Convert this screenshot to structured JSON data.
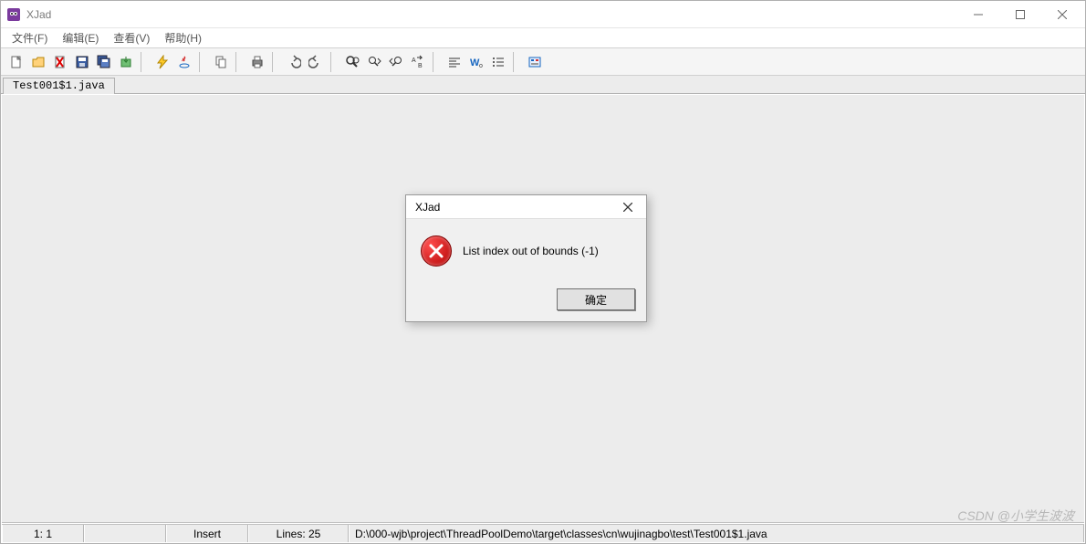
{
  "window": {
    "title": "XJad"
  },
  "menu": {
    "file": "文件(F)",
    "edit": "编辑(E)",
    "view": "查看(V)",
    "help": "帮助(H)"
  },
  "toolbar": {
    "icons": [
      "new-file-icon",
      "open-file-icon",
      "delete-icon",
      "save-icon",
      "save-all-icon",
      "export-icon",
      "sep",
      "lightning-icon",
      "java-icon",
      "sep",
      "copy-icon",
      "sep",
      "print-icon",
      "sep",
      "undo-icon",
      "redo-icon",
      "sep",
      "find-icon",
      "find-next-icon",
      "find-prev-icon",
      "replace-icon",
      "sep",
      "align-left-icon",
      "wrap-icon",
      "list-icon",
      "sep",
      "options-icon"
    ]
  },
  "tabs": {
    "active": "Test001$1.java"
  },
  "statusbar": {
    "position": "1:  1",
    "mode": "Insert",
    "lines": "Lines: 25",
    "path": "D:\\000-wjb\\project\\ThreadPoolDemo\\target\\classes\\cn\\wujinagbo\\test\\Test001$1.java"
  },
  "dialog": {
    "title": "XJad",
    "message": "List index out of bounds (-1)",
    "ok": "确定"
  },
  "watermark": "CSDN @小学生波波"
}
